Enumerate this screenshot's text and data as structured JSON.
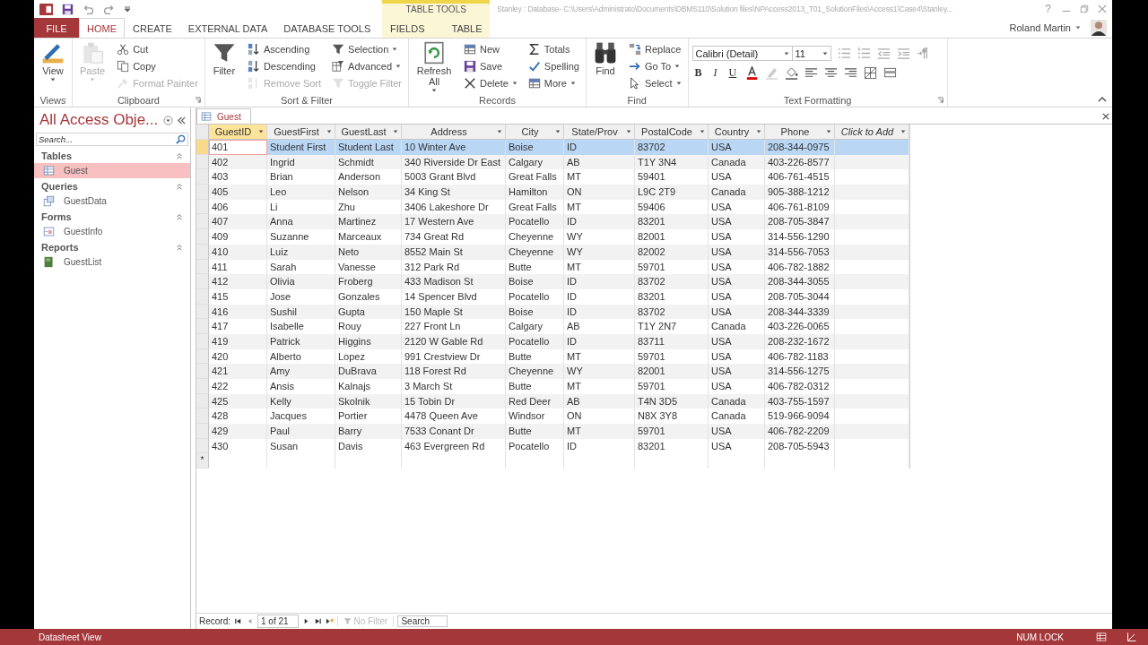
{
  "title_bar": {
    "contextual_tab_group": "TABLE TOOLS",
    "title": "Stanley : Database- C:\\Users\\Administrato\\Documents\\DBMS110\\Solution files\\NPAccess2013_T01_SolutionFiles\\Access1\\Case4\\Stanley...",
    "help": "?",
    "user": "Roland Martin"
  },
  "ribbon_tabs": [
    {
      "label": "FILE",
      "kind": "file",
      "selected": false
    },
    {
      "label": "HOME",
      "kind": "normal",
      "selected": true
    },
    {
      "label": "CREATE",
      "kind": "normal",
      "selected": false
    },
    {
      "label": "EXTERNAL DATA",
      "kind": "normal",
      "selected": false
    },
    {
      "label": "DATABASE TOOLS",
      "kind": "normal",
      "selected": false
    },
    {
      "label": "FIELDS",
      "kind": "contextual",
      "selected": false
    },
    {
      "label": "TABLE",
      "kind": "contextual",
      "selected": false
    }
  ],
  "ribbon_groups": [
    {
      "label": "Views",
      "launcher": false,
      "columns": [
        [
          {
            "label": "View",
            "kind": "large",
            "dropdown": true,
            "disabled": false
          }
        ]
      ]
    },
    {
      "label": "Clipboard",
      "launcher": true,
      "columns": [
        [
          {
            "label": "Paste",
            "kind": "large",
            "dropdown": true,
            "disabled": true
          }
        ],
        [
          {
            "label": "Cut",
            "kind": "small",
            "dropdown": false,
            "disabled": false
          },
          {
            "label": "Copy",
            "kind": "small",
            "dropdown": false,
            "disabled": false
          },
          {
            "label": "Format Painter",
            "kind": "small",
            "dropdown": false,
            "disabled": true
          }
        ]
      ]
    },
    {
      "label": "Sort & Filter",
      "launcher": false,
      "columns": [
        [
          {
            "label": "Filter",
            "kind": "large",
            "dropdown": false,
            "disabled": false
          }
        ],
        [
          {
            "label": "Ascending",
            "kind": "small",
            "dropdown": false,
            "disabled": false
          },
          {
            "label": "Descending",
            "kind": "small",
            "dropdown": false,
            "disabled": false
          },
          {
            "label": "Remove Sort",
            "kind": "small",
            "dropdown": false,
            "disabled": true
          }
        ],
        [
          {
            "label": "Selection",
            "kind": "small",
            "dropdown": true,
            "disabled": false
          },
          {
            "label": "Advanced",
            "kind": "small",
            "dropdown": true,
            "disabled": false
          },
          {
            "label": "Toggle Filter",
            "kind": "small",
            "dropdown": false,
            "disabled": true
          }
        ]
      ]
    },
    {
      "label": "Records",
      "launcher": false,
      "columns": [
        [
          {
            "label": "Refresh All",
            "kind": "large",
            "dropdown": true,
            "disabled": false
          }
        ],
        [
          {
            "label": "New",
            "kind": "small",
            "dropdown": false,
            "disabled": false
          },
          {
            "label": "Save",
            "kind": "small",
            "dropdown": false,
            "disabled": false
          },
          {
            "label": "Delete",
            "kind": "small",
            "dropdown": true,
            "disabled": false
          }
        ],
        [
          {
            "label": "Totals",
            "kind": "small",
            "dropdown": false,
            "disabled": false
          },
          {
            "label": "Spelling",
            "kind": "small",
            "dropdown": false,
            "disabled": false
          },
          {
            "label": "More",
            "kind": "small",
            "dropdown": true,
            "disabled": false
          }
        ]
      ]
    },
    {
      "label": "Find",
      "launcher": false,
      "columns": [
        [
          {
            "label": "Find",
            "kind": "large",
            "dropdown": false,
            "disabled": false
          }
        ],
        [
          {
            "label": "Replace",
            "kind": "small",
            "dropdown": false,
            "disabled": false
          },
          {
            "label": "Go To",
            "kind": "small",
            "dropdown": true,
            "disabled": false
          },
          {
            "label": "Select",
            "kind": "small",
            "dropdown": true,
            "disabled": false
          }
        ]
      ]
    }
  ],
  "text_formatting": {
    "label": "Text Formatting",
    "font": "Calibri (Detail)",
    "size": "11",
    "style_buttons": [
      "B",
      "I",
      "U"
    ]
  },
  "navigation_pane": {
    "title": "All Access Obje...",
    "search": {
      "placeholder": "Search..."
    },
    "groups": [
      {
        "label": "Tables",
        "expanded": true,
        "items": [
          {
            "label": "Guest",
            "kind": "table",
            "selected": true
          }
        ]
      },
      {
        "label": "Queries",
        "expanded": true,
        "items": [
          {
            "label": "GuestData",
            "kind": "query",
            "selected": false
          }
        ]
      },
      {
        "label": "Forms",
        "expanded": true,
        "items": [
          {
            "label": "GuestInfo",
            "kind": "form",
            "selected": false
          }
        ]
      },
      {
        "label": "Reports",
        "expanded": true,
        "items": [
          {
            "label": "GuestList",
            "kind": "report",
            "selected": false
          }
        ]
      }
    ]
  },
  "document_tab": "Guest",
  "table": {
    "columns": [
      {
        "label": "GuestID",
        "kind": "field",
        "selected": true
      },
      {
        "label": "GuestFirst",
        "kind": "field",
        "selected": false
      },
      {
        "label": "GuestLast",
        "kind": "field",
        "selected": false
      },
      {
        "label": "Address",
        "kind": "field",
        "selected": false
      },
      {
        "label": "City",
        "kind": "field",
        "selected": false
      },
      {
        "label": "State/Prov",
        "kind": "field",
        "selected": false
      },
      {
        "label": "PostalCode",
        "kind": "field",
        "selected": false
      },
      {
        "label": "Country",
        "kind": "field",
        "selected": false
      },
      {
        "label": "Phone",
        "kind": "field",
        "selected": false
      },
      {
        "label": "Click to Add",
        "kind": "add",
        "selected": false
      }
    ],
    "rows": [
      {
        "selected": true,
        "cells": [
          "401",
          "Student First",
          "Student Last",
          "10 Winter Ave",
          "Boise",
          "ID",
          "83702",
          "USA",
          "208-344-0975"
        ]
      },
      {
        "selected": false,
        "cells": [
          "402",
          "Ingrid",
          "Schmidt",
          "340 Riverside Dr East",
          "Calgary",
          "AB",
          "T1Y 3N4",
          "Canada",
          "403-226-8577"
        ]
      },
      {
        "selected": false,
        "cells": [
          "403",
          "Brian",
          "Anderson",
          "5003 Grant Blvd",
          "Great Falls",
          "MT",
          "59401",
          "USA",
          "406-761-4515"
        ]
      },
      {
        "selected": false,
        "cells": [
          "405",
          "Leo",
          "Nelson",
          "34 King St",
          "Hamilton",
          "ON",
          "L9C 2T9",
          "Canada",
          "905-388-1212"
        ]
      },
      {
        "selected": false,
        "cells": [
          "406",
          "Li",
          "Zhu",
          "3406 Lakeshore Dr",
          "Great Falls",
          "MT",
          "59406",
          "USA",
          "406-761-8109"
        ]
      },
      {
        "selected": false,
        "cells": [
          "407",
          "Anna",
          "Martinez",
          "17 Western Ave",
          "Pocatello",
          "ID",
          "83201",
          "USA",
          "208-705-3847"
        ]
      },
      {
        "selected": false,
        "cells": [
          "409",
          "Suzanne",
          "Marceaux",
          "734 Great Rd",
          "Cheyenne",
          "WY",
          "82001",
          "USA",
          "314-556-1290"
        ]
      },
      {
        "selected": false,
        "cells": [
          "410",
          "Luiz",
          "Neto",
          "8552 Main St",
          "Cheyenne",
          "WY",
          "82002",
          "USA",
          "314-556-7053"
        ]
      },
      {
        "selected": false,
        "cells": [
          "411",
          "Sarah",
          "Vanesse",
          "312 Park Rd",
          "Butte",
          "MT",
          "59701",
          "USA",
          "406-782-1882"
        ]
      },
      {
        "selected": false,
        "cells": [
          "412",
          "Olivia",
          "Froberg",
          "433 Madison St",
          "Boise",
          "ID",
          "83702",
          "USA",
          "208-344-3055"
        ]
      },
      {
        "selected": false,
        "cells": [
          "415",
          "Jose",
          "Gonzales",
          "14 Spencer Blvd",
          "Pocatello",
          "ID",
          "83201",
          "USA",
          "208-705-3044"
        ]
      },
      {
        "selected": false,
        "cells": [
          "416",
          "Sushil",
          "Gupta",
          "150 Maple St",
          "Boise",
          "ID",
          "83702",
          "USA",
          "208-344-3339"
        ]
      },
      {
        "selected": false,
        "cells": [
          "417",
          "Isabelle",
          "Rouy",
          "227 Front Ln",
          "Calgary",
          "AB",
          "T1Y 2N7",
          "Canada",
          "403-226-0065"
        ]
      },
      {
        "selected": false,
        "cells": [
          "419",
          "Patrick",
          "Higgins",
          "2120 W Gable Rd",
          "Pocatello",
          "ID",
          "83711",
          "USA",
          "208-232-1672"
        ]
      },
      {
        "selected": false,
        "cells": [
          "420",
          "Alberto",
          "Lopez",
          "991 Crestview Dr",
          "Butte",
          "MT",
          "59701",
          "USA",
          "406-782-1183"
        ]
      },
      {
        "selected": false,
        "cells": [
          "421",
          "Amy",
          "DuBrava",
          "118 Forest Rd",
          "Cheyenne",
          "WY",
          "82001",
          "USA",
          "314-556-1275"
        ]
      },
      {
        "selected": false,
        "cells": [
          "422",
          "Ansis",
          "Kalnajs",
          "3 March St",
          "Butte",
          "MT",
          "59701",
          "USA",
          "406-782-0312"
        ]
      },
      {
        "selected": false,
        "cells": [
          "425",
          "Kelly",
          "Skolnik",
          "15 Tobin Dr",
          "Red Deer",
          "AB",
          "T4N 3D5",
          "Canada",
          "403-755-1597"
        ]
      },
      {
        "selected": false,
        "cells": [
          "428",
          "Jacques",
          "Portier",
          "4478 Queen Ave",
          "Windsor",
          "ON",
          "N8X 3Y8",
          "Canada",
          "519-966-9094"
        ]
      },
      {
        "selected": false,
        "cells": [
          "429",
          "Paul",
          "Barry",
          "7533 Conant Dr",
          "Butte",
          "MT",
          "59701",
          "USA",
          "406-782-2209"
        ]
      },
      {
        "selected": false,
        "cells": [
          "430",
          "Susan",
          "Davis",
          "463 Evergreen Rd",
          "Pocatello",
          "ID",
          "83201",
          "USA",
          "208-705-5943"
        ]
      }
    ],
    "new_row_marker": "*"
  },
  "record_navigator": {
    "label": "Record:",
    "position": "1 of 21",
    "filter": "No Filter",
    "filter_active": false,
    "search": {
      "placeholder": "Search"
    }
  },
  "status_bar": {
    "view": "Datasheet View",
    "indicators": [
      "NUM LOCK"
    ]
  }
}
